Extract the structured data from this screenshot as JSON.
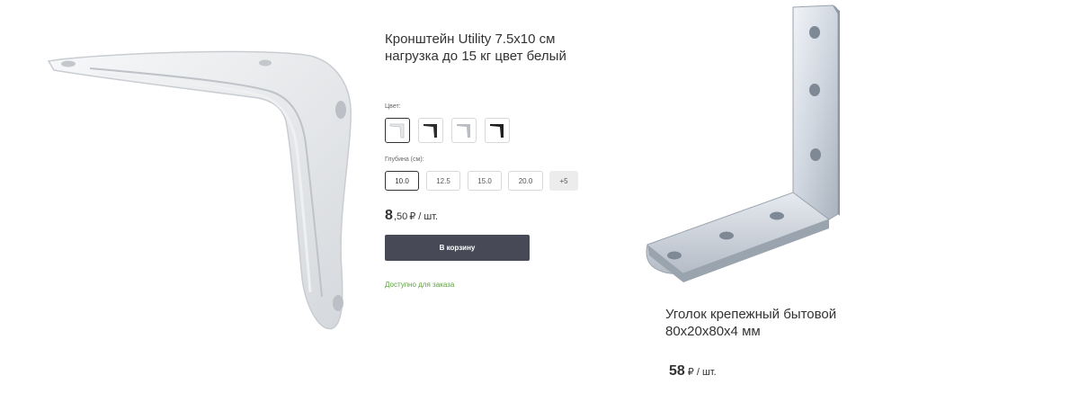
{
  "product1": {
    "title": "Кронштейн Utility 7.5x10 см нагрузка до 15 кг цвет белый",
    "color_label": "Цвет:",
    "swatches": [
      {
        "name": "white",
        "color": "#e9eaec"
      },
      {
        "name": "black",
        "color": "#2b2b2b"
      },
      {
        "name": "grey",
        "color": "#b9bcc0"
      },
      {
        "name": "black-2",
        "color": "#1f1f1f"
      }
    ],
    "depth_label": "Глубина (см):",
    "depth_options": [
      "10.0",
      "12.5",
      "15.0",
      "20.0"
    ],
    "depth_more": "+5",
    "price_int": "8",
    "price_frac": ",50",
    "price_unit": "₽ / шт.",
    "cart_button": "В корзину",
    "availability": "Доступно для заказа"
  },
  "product2": {
    "title": "Уголок крепежный бытовой 80x20x80x4 мм",
    "price": "58",
    "price_unit": "₽ / шт."
  },
  "colors": {
    "button_bg": "#474a56",
    "available_green": "#5ba53b"
  }
}
